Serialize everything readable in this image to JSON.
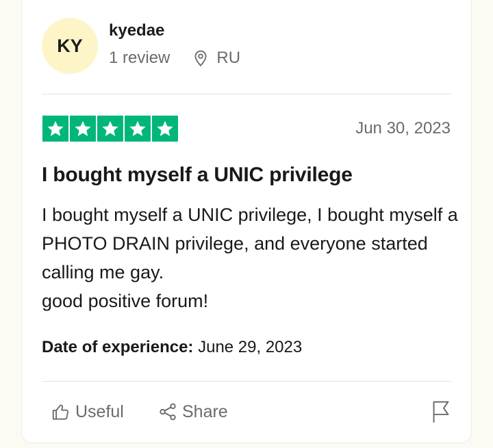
{
  "reviewer": {
    "initials": "KY",
    "name": "kyedae",
    "review_count": "1 review",
    "location_icon": "map-pin-icon",
    "country": "RU"
  },
  "review": {
    "rating": 5,
    "star_color": "#00b67a",
    "date": "Jun 30, 2023",
    "title": "I bought myself a UNIC privilege",
    "body_lines": [
      "I bought myself a UNIC privilege, I bought myself a PHOTO DRAIN privilege, and everyone started calling me gay.",
      "good positive forum!"
    ],
    "experience_label": "Date of experience:",
    "experience_date": " June 29, 2023"
  },
  "actions": {
    "useful_label": "Useful",
    "useful_icon": "thumbs-up-icon",
    "share_label": "Share",
    "share_icon": "share-icon",
    "flag_icon": "flag-icon"
  }
}
